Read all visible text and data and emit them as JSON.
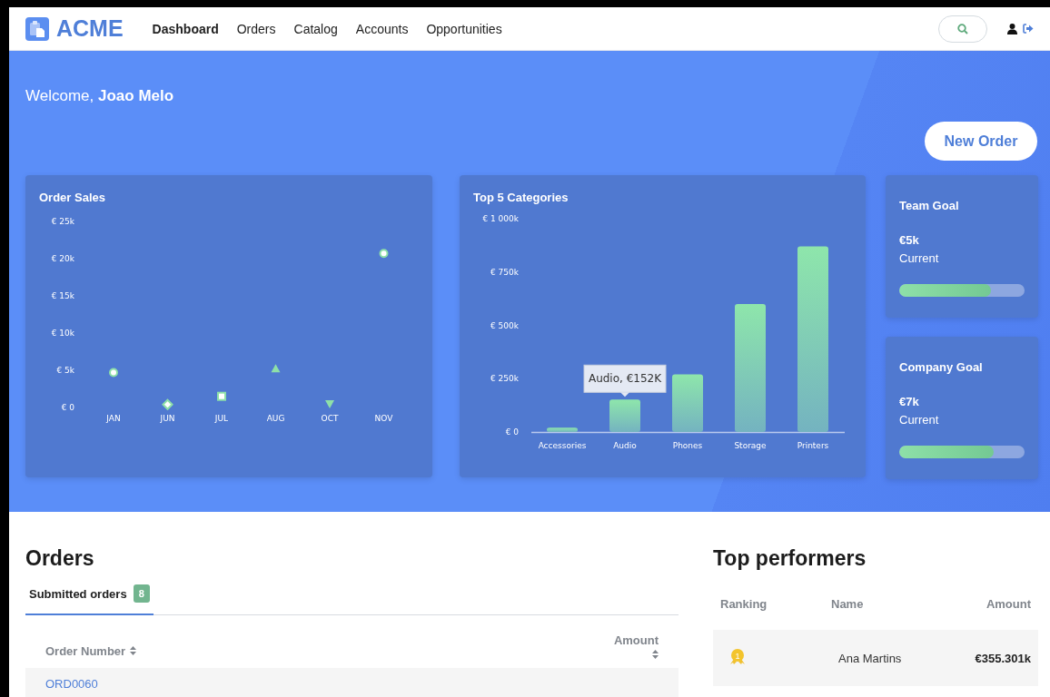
{
  "header": {
    "logo": "ACME",
    "nav": [
      {
        "label": "Dashboard",
        "selected": true
      },
      {
        "label": "Orders",
        "selected": false
      },
      {
        "label": "Catalog",
        "selected": false
      },
      {
        "label": "Accounts",
        "selected": false
      },
      {
        "label": "Opportunities",
        "selected": false
      }
    ]
  },
  "hero": {
    "welcome": "Welcome, **Joao Melo**",
    "new_order_button": "New Order"
  },
  "order_sales": {
    "title": "Order Sales",
    "chart_data": {
      "type": "scatter",
      "categories": [
        "JAN",
        "JUN",
        "JUL",
        "AUG",
        "OCT",
        "NOV"
      ],
      "values": [
        4700,
        400,
        1500,
        5200,
        500,
        20700
      ],
      "ylim": [
        0,
        25000
      ],
      "yticks": [
        {
          "value": 0,
          "label": "€ 0"
        },
        {
          "value": 5000,
          "label": "€ 5k"
        },
        {
          "value": 10000,
          "label": "€ 10k"
        },
        {
          "value": 15000,
          "label": "€ 15k"
        },
        {
          "value": 20000,
          "label": "€ 20k"
        },
        {
          "value": 25000,
          "label": "€ 25k"
        }
      ]
    }
  },
  "top_categories": {
    "title": "Top 5 Categories",
    "chart_data": {
      "type": "bar",
      "categories": [
        "Accessories",
        "Audio",
        "Phones",
        "Storage",
        "Printers"
      ],
      "values": [
        20000,
        152000,
        270000,
        600000,
        870000
      ],
      "ylim": [
        0,
        1000000
      ],
      "yticks": [
        {
          "value": 0,
          "label": "€ 0"
        },
        {
          "value": 250000,
          "label": "€ 250k"
        },
        {
          "value": 500000,
          "label": "€ 500k"
        },
        {
          "value": 750000,
          "label": "€ 750k"
        },
        {
          "value": 1000000,
          "label": "€ 1 000k"
        }
      ],
      "annotations": [
        {
          "x": "Audio",
          "y": 152000,
          "text": "Audio, €152K"
        }
      ]
    }
  },
  "goals": [
    {
      "title": "Team Goal",
      "value": "€5k",
      "caption": "Current",
      "level": 0.73
    },
    {
      "title": "Company Goal",
      "value": "€7k",
      "caption": "Current",
      "level": 0.75
    }
  ],
  "orders": {
    "title": "Orders",
    "tabs": [
      {
        "label": "Submitted orders",
        "count": "8",
        "selected": true
      }
    ],
    "columns": [
      "Order Number",
      "Amount"
    ],
    "rows": [
      {
        "order_number": "ORD0060"
      }
    ]
  },
  "top_performers": {
    "title": "Top performers",
    "columns": [
      "Ranking",
      "Name",
      "Amount"
    ],
    "rows": [
      {
        "rank": "1",
        "name": "Ana Martins",
        "amount": "€355.301k"
      }
    ]
  }
}
